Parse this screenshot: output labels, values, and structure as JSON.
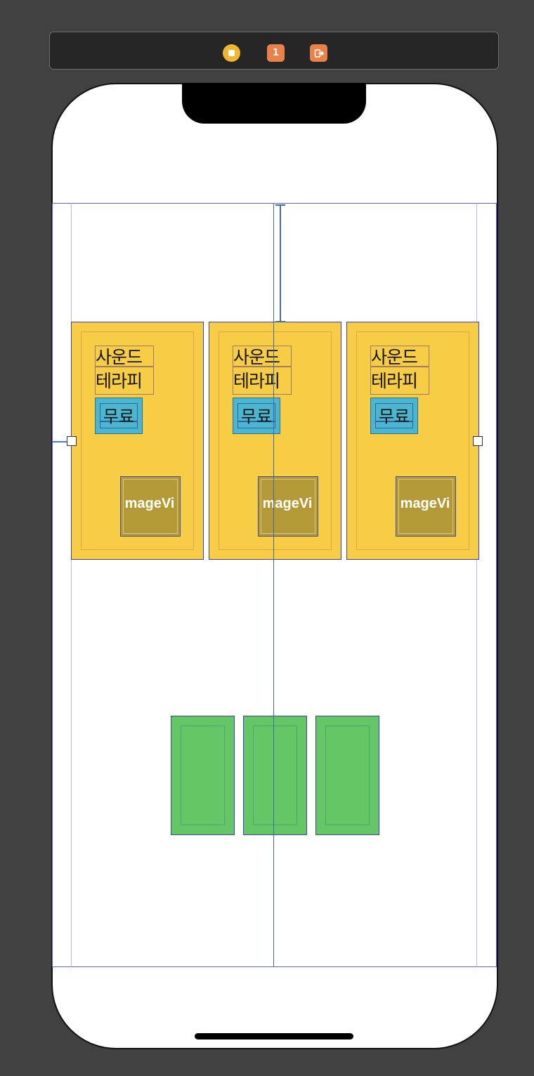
{
  "toolbar": {
    "icons": [
      "view-controller-icon",
      "first-responder-icon",
      "exit-icon"
    ],
    "first_responder_label": "1",
    "exit_glyph": "⇨"
  },
  "cards": [
    {
      "title": "사운드\n테라피",
      "badge": "무료",
      "image_label": "mageVi"
    },
    {
      "title": "사운드\n테라피",
      "badge": "무료",
      "image_label": "mageVi"
    },
    {
      "title": "사운드\n테라피",
      "badge": "무료",
      "image_label": "mageVi"
    }
  ],
  "green_cards_count": 3,
  "colors": {
    "canvas": "#414141",
    "card_yellow": "#f7cd46",
    "badge_cyan": "#4bb7cf",
    "image_bg": "#b49a37",
    "green": "#64c665",
    "constraint_blue": "#3f6ba9",
    "accent_vc": "#f0b62f",
    "accent_orange": "#e9814a"
  }
}
